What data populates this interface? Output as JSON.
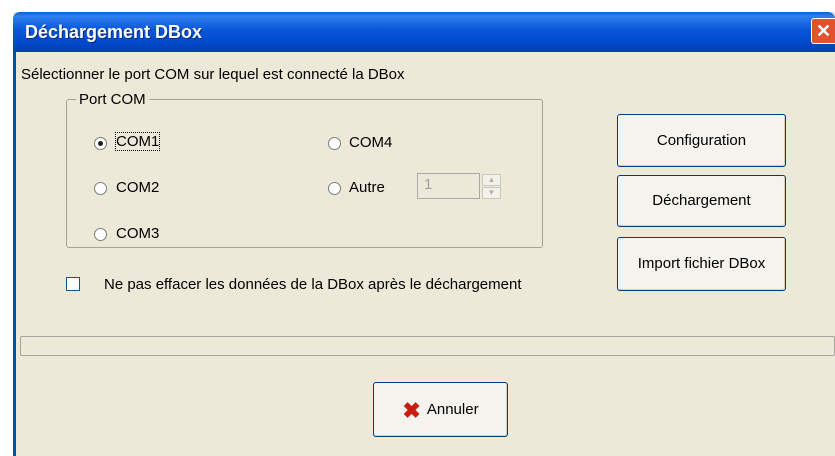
{
  "window": {
    "title": "Déchargement DBox",
    "close_glyph": "✕"
  },
  "instruction": "Sélectionner le port COM sur lequel est connecté la DBox",
  "port_group": {
    "legend": "Port COM",
    "selected": "COM1",
    "radios": {
      "com1": "COM1",
      "com2": "COM2",
      "com3": "COM3",
      "com4": "COM4",
      "autre": "Autre"
    },
    "autre_value": "1"
  },
  "checkbox": {
    "label": "Ne pas effacer les données de la DBox après le déchargement",
    "checked": false
  },
  "buttons": {
    "configuration": "Configuration",
    "dechargement": "Déchargement",
    "import": "Import fichier DBox",
    "annuler": "Annuler"
  },
  "progress": {
    "value": 0
  },
  "icons": {
    "annuler": "red-x-icon",
    "close": "close-icon"
  }
}
